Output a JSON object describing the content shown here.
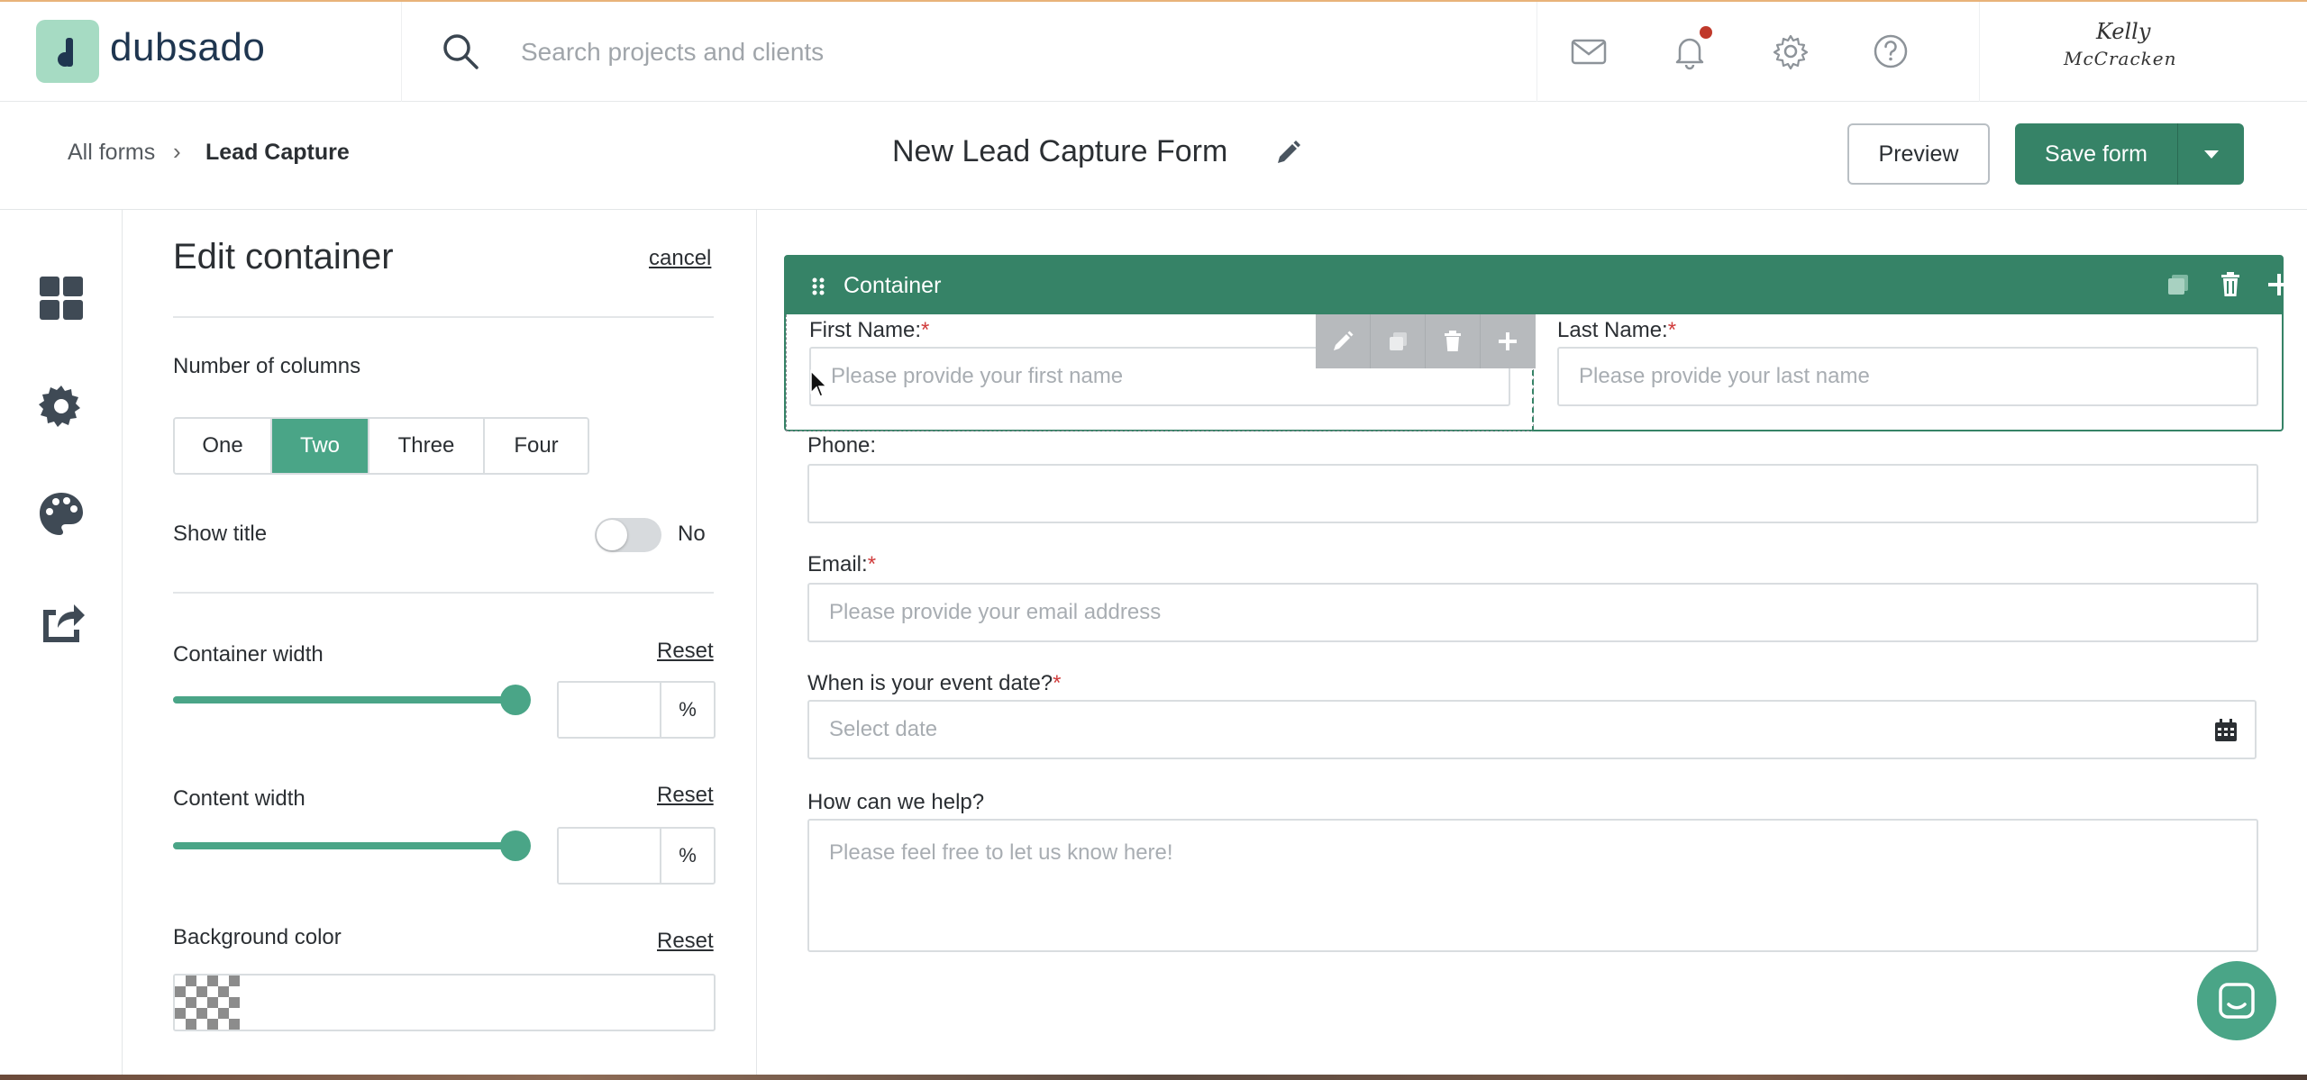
{
  "brand": {
    "name": "dubsado",
    "accent": "#368367",
    "accent_light": "#4aa587"
  },
  "topbar": {
    "search_placeholder": "Search projects and clients",
    "icons": [
      "mail-icon",
      "bell-icon",
      "gear-icon",
      "help-icon"
    ],
    "signature_line1": "Kelly",
    "signature_line2": "McCracken"
  },
  "subheader": {
    "breadcrumb_root": "All forms",
    "breadcrumb_sep": "›",
    "breadcrumb_current": "Lead Capture",
    "form_title": "New Lead Capture Form",
    "preview_label": "Preview",
    "save_label": "Save form"
  },
  "rail": {
    "icons": [
      "layout-icon",
      "settings-icon",
      "palette-icon",
      "share-icon"
    ]
  },
  "panel": {
    "title": "Edit container",
    "cancel": "cancel",
    "columns_label": "Number of columns",
    "column_options": [
      "One",
      "Two",
      "Three",
      "Four"
    ],
    "columns_selected": "Two",
    "show_title_label": "Show title",
    "show_title_value": "No",
    "container_width_label": "Container width",
    "container_width_reset": "Reset",
    "container_width_fraction": 1.0,
    "container_width_unit": "%",
    "content_width_label": "Content width",
    "content_width_reset": "Reset",
    "content_width_fraction": 1.0,
    "content_width_unit": "%",
    "background_label": "Background color",
    "background_reset": "Reset"
  },
  "canvas": {
    "container_title": "Container",
    "first_name_label": "First Name:",
    "first_name_placeholder": "Please provide your first name",
    "last_name_label": "Last Name:",
    "last_name_placeholder": "Please provide your last name",
    "phone_label": "Phone:",
    "email_label": "Email:",
    "email_placeholder": "Please provide your email address",
    "event_date_label": "When is your event date?",
    "event_date_placeholder": "Select date",
    "help_label": "How can we help?",
    "help_placeholder": "Please feel free to let us know here!",
    "required_mark": "*"
  }
}
